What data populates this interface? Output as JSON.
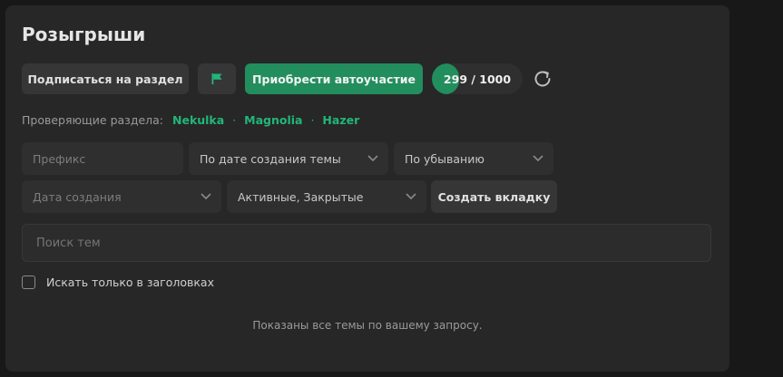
{
  "section": {
    "title": "Розыгрыши"
  },
  "toolbar": {
    "subscribe_label": "Подписаться на раздел",
    "flag_icon": "flag-icon",
    "autojoin_label": "Приобрести автоучастие",
    "progress": {
      "current": 299,
      "max": 1000,
      "text": "299 / 1000"
    },
    "refresh_icon": "refresh-icon",
    "accent": "#228e5d"
  },
  "moderators": {
    "label": "Проверяющие раздела:",
    "names": [
      "Nekulka",
      "Magnolia",
      "Hazer"
    ],
    "color": "#22b679"
  },
  "filters": {
    "prefix_placeholder": "Префикс",
    "sort_by": "По дате создания темы",
    "sort_order": "По убыванию",
    "date_placeholder": "Дата создания",
    "status": "Активные, Закрытые",
    "create_tab_label": "Создать вкладку"
  },
  "search": {
    "placeholder": "Поиск тем"
  },
  "options": {
    "titles_only_label": "Искать только в заголовках",
    "titles_only_checked": false
  },
  "results": {
    "message": "Показаны все темы по вашему запросу."
  }
}
